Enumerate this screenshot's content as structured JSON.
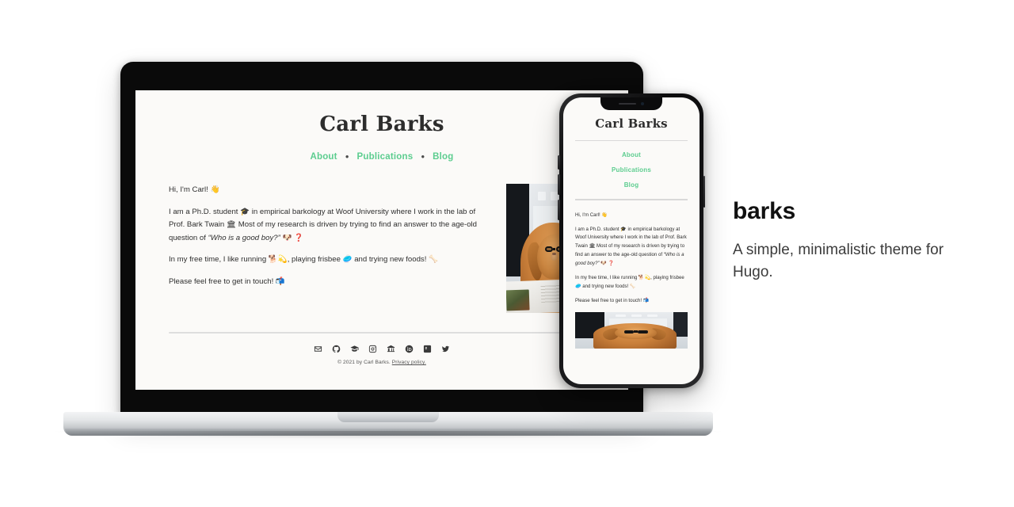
{
  "site": {
    "title": "Carl Barks",
    "nav": [
      {
        "label": "About"
      },
      {
        "label": "Publications"
      },
      {
        "label": "Blog"
      }
    ],
    "nav_separator": "●",
    "bio": {
      "greeting": "Hi, I'm Carl! 👋",
      "paragraph_2_a": "I am a Ph.D. student 🎓 in empirical barkology at Woof University where I work in the lab of Prof. Bark Twain 🏛 Most of my research is driven by trying to find an answer to the age-old question of ",
      "paragraph_2_quote": "“Who is a good boy?”",
      "paragraph_2_b": " 🐶 ❓",
      "paragraph_3": "In my free time, I like running 🐕💫, playing frisbee 🥏 and trying new foods! 🦴",
      "paragraph_4": "Please feel free to get in touch! 📬"
    },
    "social_icons": [
      {
        "name": "envelope-icon"
      },
      {
        "name": "github-icon"
      },
      {
        "name": "graduation-cap-icon"
      },
      {
        "name": "instagram-icon"
      },
      {
        "name": "university-icon"
      },
      {
        "name": "orcid-icon"
      },
      {
        "name": "researchgate-icon"
      },
      {
        "name": "twitter-icon"
      }
    ],
    "footer": {
      "copyright": "© 2021 by Carl Barks. ",
      "privacy_label": "Privacy policy."
    },
    "photo_alt": "dog-with-glasses-photo"
  },
  "promo": {
    "title": "barks",
    "subtitle": "A simple, minimalistic theme for Hugo."
  },
  "colors": {
    "accent_green": "#5ccd8f",
    "page_background": "#FBFAF8",
    "text": "#2e2e2e",
    "device_frame": "#0a0a0a"
  },
  "devices": {
    "laptop": {
      "name": "laptop-mockup"
    },
    "phone": {
      "name": "phone-mockup"
    }
  }
}
